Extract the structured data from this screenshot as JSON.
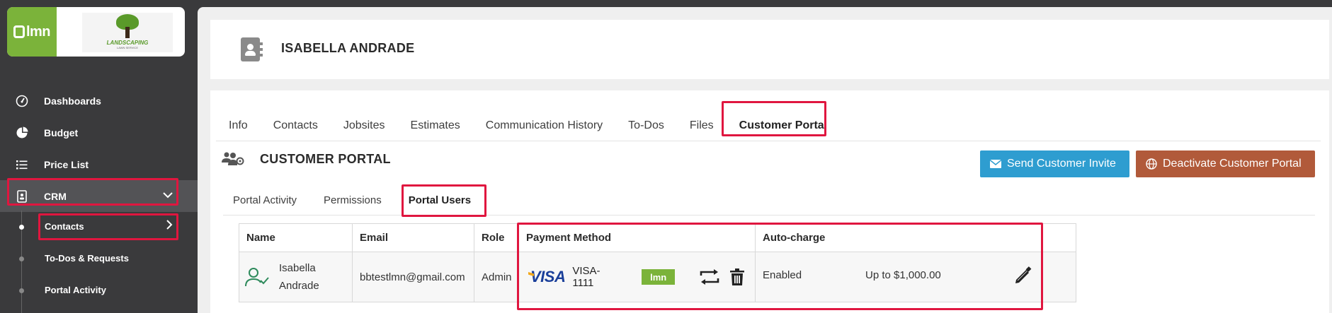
{
  "brand": {
    "lmn_logo": "lmn",
    "company_name": "LANDSCAPING",
    "company_sub": "LAWN SERVICE"
  },
  "sidebar": {
    "items": [
      {
        "label": "Dashboards",
        "icon": "gauge-icon"
      },
      {
        "label": "Budget",
        "icon": "pie-chart-icon"
      },
      {
        "label": "Price List",
        "icon": "list-icon"
      },
      {
        "label": "CRM",
        "icon": "contact-card-icon"
      }
    ],
    "sub_items": [
      {
        "label": "Contacts"
      },
      {
        "label": "To-Dos & Requests"
      },
      {
        "label": "Portal Activity"
      }
    ]
  },
  "header": {
    "contact_name": "ISABELLA ANDRADE"
  },
  "tabs": [
    {
      "label": "Info"
    },
    {
      "label": "Contacts"
    },
    {
      "label": "Jobsites"
    },
    {
      "label": "Estimates"
    },
    {
      "label": "Communication History"
    },
    {
      "label": "To-Dos"
    },
    {
      "label": "Files"
    },
    {
      "label": "Customer Portal"
    }
  ],
  "portal": {
    "title": "CUSTOMER PORTAL",
    "send_invite_label": "Send Customer Invite",
    "deactivate_label": "Deactivate Customer Portal",
    "subtabs": [
      {
        "label": "Portal Activity"
      },
      {
        "label": "Permissions"
      },
      {
        "label": "Portal Users"
      }
    ]
  },
  "table": {
    "headers": {
      "name": "Name",
      "email": "Email",
      "role": "Role",
      "payment": "Payment Method",
      "autocharge": "Auto-charge"
    },
    "row": {
      "first_name": "Isabella",
      "last_name": "Andrade",
      "email": "bbtestlmn@gmail.com",
      "role": "Admin",
      "card_brand": "VISA",
      "card_number": "VISA-1111",
      "processor": "lmn",
      "autocharge_status": "Enabled",
      "autocharge_limit": "Up to $1,000.00"
    }
  },
  "colors": {
    "accent_highlight": "#e0163f",
    "lmn_green": "#7bb33a",
    "invite_blue": "#2e9dd0",
    "deactivate_brown": "#b15a3a",
    "sidebar_bg": "#3a3a3c"
  }
}
